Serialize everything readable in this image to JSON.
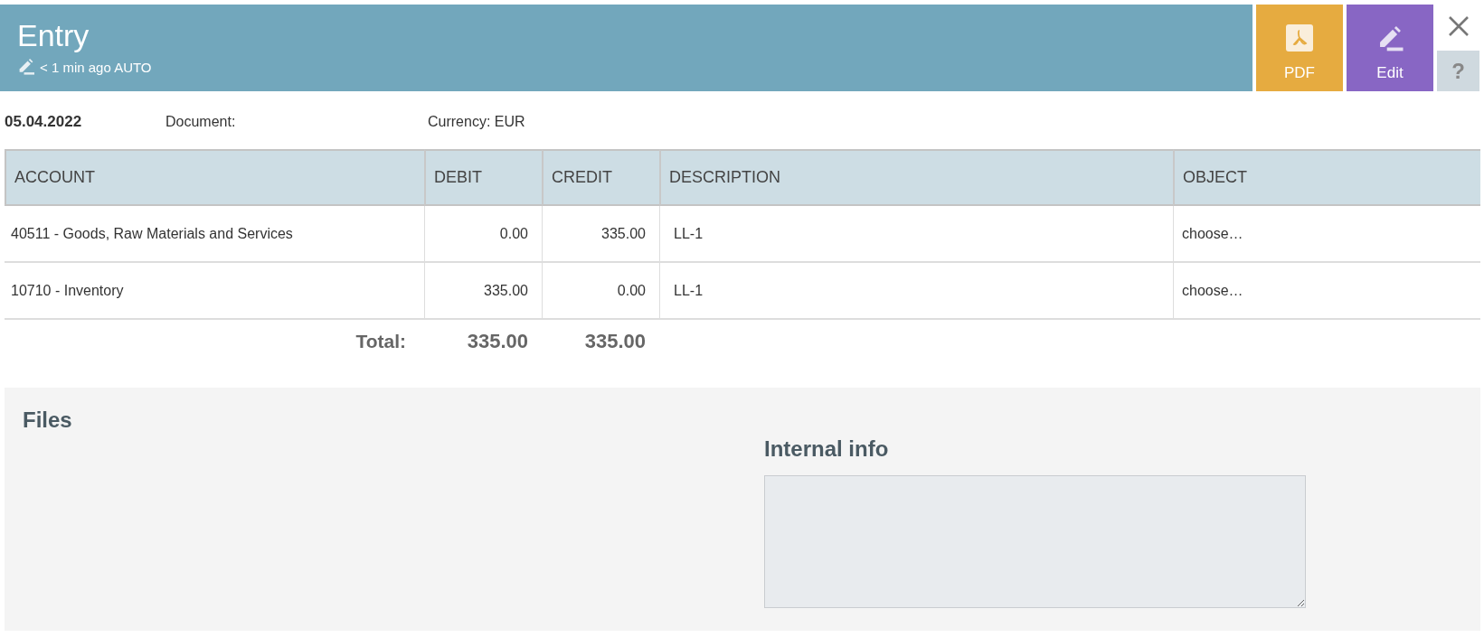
{
  "header": {
    "title": "Entry",
    "subtitle": "< 1 min ago AUTO"
  },
  "actions": [
    {
      "kind": "pdf",
      "label": "PDF"
    },
    {
      "kind": "edit",
      "label": "Edit"
    }
  ],
  "help": "?",
  "meta": {
    "date": "05.04.2022",
    "document": "Document:",
    "currency": "Currency: EUR"
  },
  "table": {
    "columns": [
      "ACCOUNT",
      "DEBIT",
      "CREDIT",
      "DESCRIPTION",
      "OBJECT"
    ],
    "rows": [
      {
        "account": "40511 - Goods, Raw Materials and Services",
        "debit": "0.00",
        "credit": "335.00",
        "description": "LL-1",
        "object": "choose…"
      },
      {
        "account": "10710 - Inventory",
        "debit": "335.00",
        "credit": "0.00",
        "description": "LL-1",
        "object": "choose…"
      }
    ]
  },
  "totals": {
    "label": "Total:",
    "debit": "335.00",
    "credit": "335.00"
  },
  "files": {
    "title": "Files"
  },
  "internal_info": {
    "title": "Internal info"
  }
}
